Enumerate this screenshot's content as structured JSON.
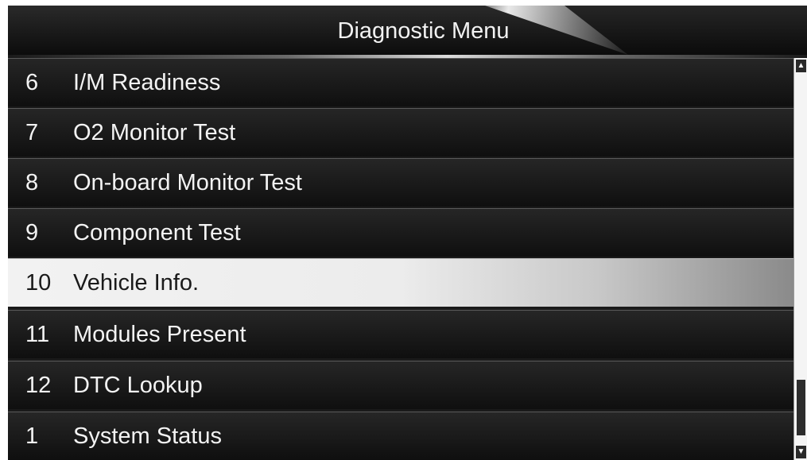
{
  "header": {
    "title": "Diagnostic Menu"
  },
  "menu": {
    "items": [
      {
        "number": "6",
        "label": "I/M Readiness"
      },
      {
        "number": "7",
        "label": "O2 Monitor Test"
      },
      {
        "number": "8",
        "label": "On-board Monitor Test"
      },
      {
        "number": "9",
        "label": "Component Test"
      },
      {
        "number": "10",
        "label": "Vehicle Info."
      },
      {
        "number": "11",
        "label": "Modules Present"
      },
      {
        "number": "12",
        "label": "DTC Lookup"
      },
      {
        "number": "1",
        "label": "System Status"
      }
    ],
    "selected_number": "10"
  },
  "scrollbar": {
    "up_icon": "arrow-up-icon",
    "down_icon": "arrow-down-icon",
    "up_glyph": "▲",
    "down_glyph": "▼"
  },
  "colors": {
    "background": "#1a1a1a",
    "row_text": "#f3f3f3",
    "selected_row": "#ececec",
    "selected_text": "#1a1a1a"
  }
}
